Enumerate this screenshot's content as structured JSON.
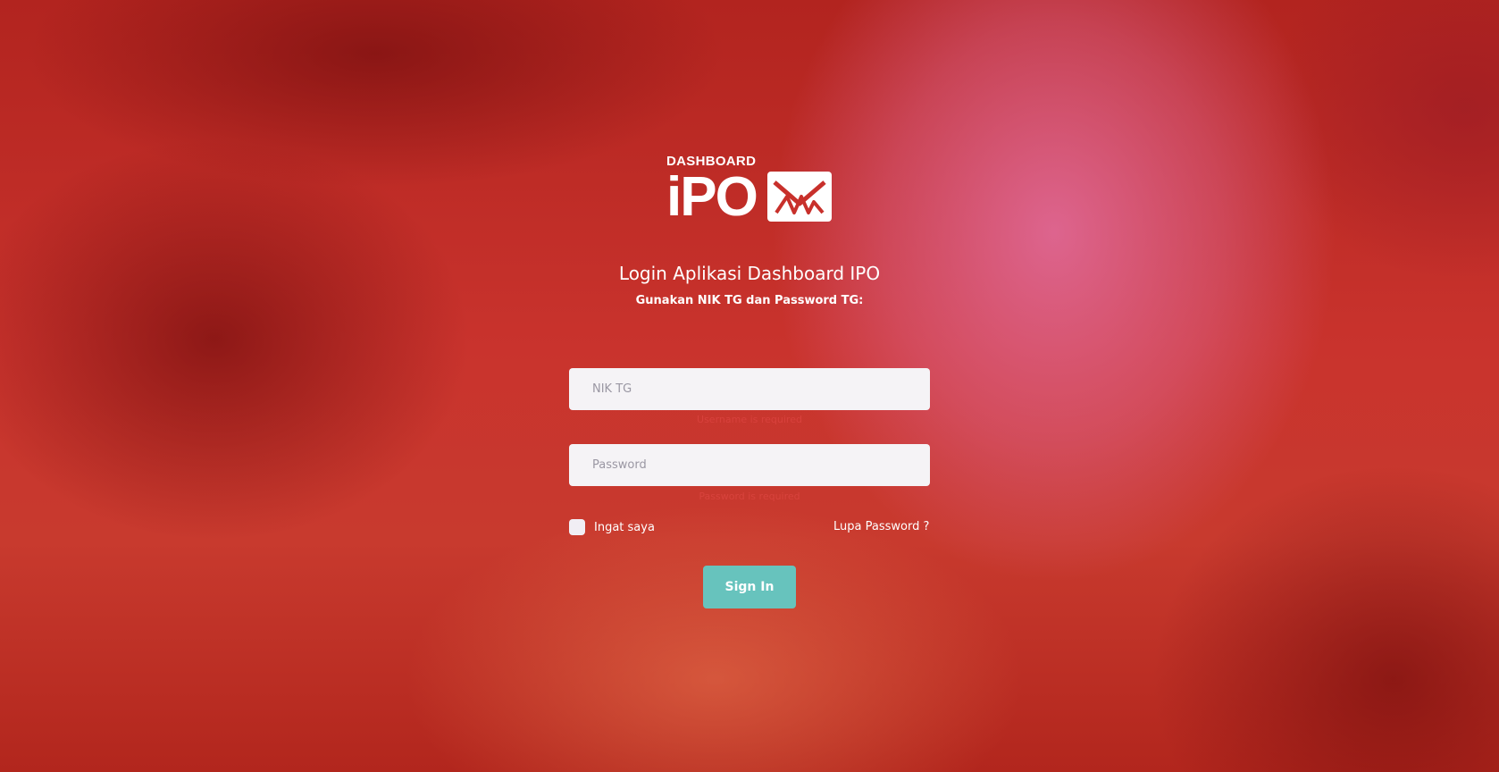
{
  "logo": {
    "top_text": "DASHBOARD",
    "main_text": "iPO",
    "mark_icon": "brand-mark-icon"
  },
  "header": {
    "title": "Login Aplikasi Dashboard IPO",
    "subtitle": "Gunakan NIK TG dan Password TG:"
  },
  "form": {
    "nik_placeholder": "NIK TG",
    "nik_value": "",
    "nik_hint": "Username is required",
    "password_placeholder": "Password",
    "password_value": "",
    "password_hint": "Password is required",
    "remember_label": "Ingat saya",
    "remember_checked": false,
    "forgot_label": "Lupa Password ?",
    "signin_label": "Sign In"
  },
  "colors": {
    "background": "#c9332d",
    "accent_pink": "#e26ea0",
    "button": "#67c3bd",
    "input_bg": "#f5f3f6"
  }
}
